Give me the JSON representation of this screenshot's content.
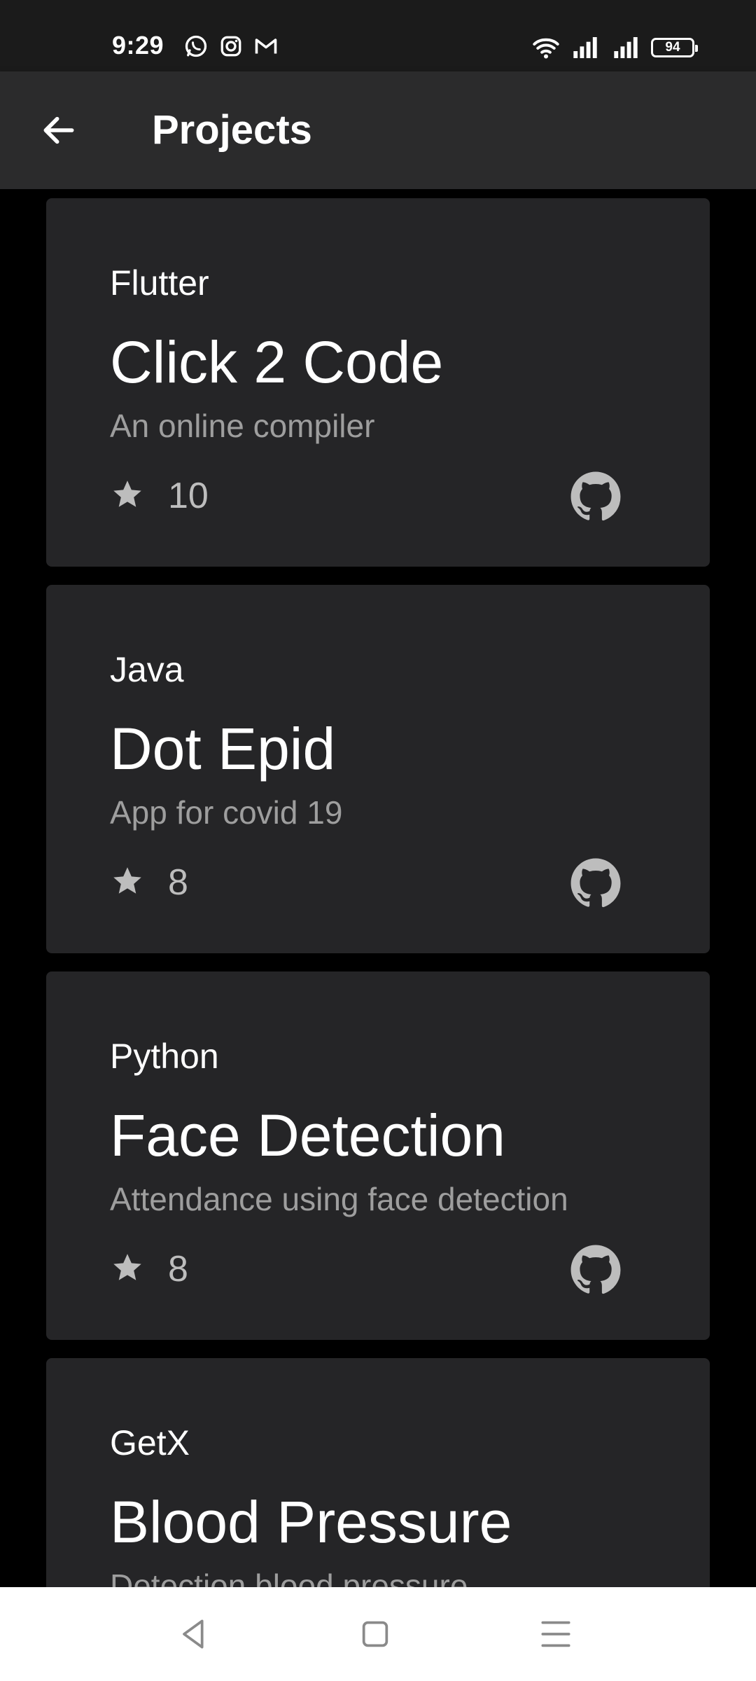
{
  "status_bar": {
    "time": "9:29",
    "left_icons": [
      "whatsapp-icon",
      "instagram-icon",
      "gmail-icon"
    ],
    "right_icons": [
      "wifi-icon",
      "signal-icon",
      "signal-icon"
    ],
    "battery": "94"
  },
  "app_bar": {
    "title": "Projects",
    "back_icon": "arrow-back-icon"
  },
  "projects": [
    {
      "language": "Flutter",
      "title": "Click 2 Code",
      "description": "An online compiler",
      "stars": "10"
    },
    {
      "language": "Java",
      "title": "Dot Epid",
      "description": "App for covid 19",
      "stars": "8"
    },
    {
      "language": "Python",
      "title": "Face Detection",
      "description": "Attendance using face detection",
      "stars": "8"
    },
    {
      "language": "GetX",
      "title": "Blood Pressure",
      "description": "Detection blood pressure",
      "stars": ""
    }
  ],
  "nav_bar": {
    "back": "triangle-back-icon",
    "home": "square-home-icon",
    "recents": "menu-lines-icon"
  },
  "colors": {
    "background": "#000000",
    "card": "#252527",
    "app_bar": "#2b2b2c",
    "secondary_text": "#9e9e9e"
  }
}
